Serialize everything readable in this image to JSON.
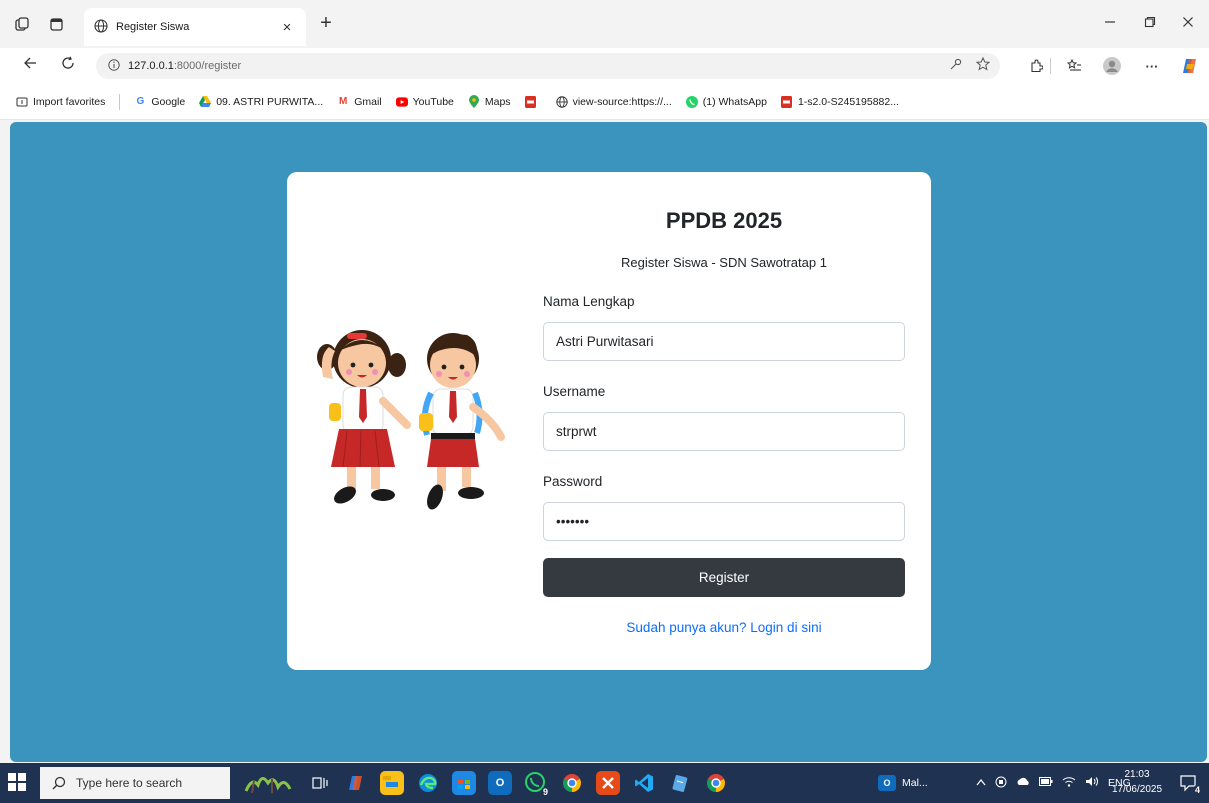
{
  "browser": {
    "tab_title": "Register Siswa",
    "tab_close": "×",
    "new_tab": "+",
    "url_host": "127.0.0.1",
    "url_rest": ":8000/register",
    "more": "···"
  },
  "favorites": [
    {
      "label": "Import favorites",
      "icon": "import-favorites-icon"
    },
    {
      "label": "Google",
      "icon": "google-icon"
    },
    {
      "label": "09. ASTRI PURWITA...",
      "icon": "google-drive-icon"
    },
    {
      "label": "Gmail",
      "icon": "gmail-icon"
    },
    {
      "label": "YouTube",
      "icon": "youtube-icon"
    },
    {
      "label": "Maps",
      "icon": "maps-icon"
    },
    {
      "label": "",
      "icon": "pdf-icon"
    },
    {
      "label": "view-source:https://...",
      "icon": "globe-icon"
    },
    {
      "label": "(1) WhatsApp",
      "icon": "whatsapp-icon"
    },
    {
      "label": "1-s2.0-S245195882...",
      "icon": "pdf-icon"
    }
  ],
  "form": {
    "title": "PPDB 2025",
    "subtitle": "Register Siswa - SDN Sawotratap 1",
    "name_label": "Nama Lengkap",
    "name_value": "Astri Purwitasari",
    "username_label": "Username",
    "username_value": "strprwt",
    "password_label": "Password",
    "password_value": "•••••••",
    "submit_label": "Register",
    "login_link": "Sudah punya akun? Login di sini"
  },
  "taskbar": {
    "search_placeholder": "Type here to search",
    "app_label": "Mal...",
    "whatsapp_badge": "9",
    "language": "ENG",
    "time": "21:03",
    "date": "17/06/2025",
    "notification_count": "4"
  },
  "colors": {
    "page_bg": "#3a94bd",
    "button_bg": "#343a40",
    "link": "#0d6efd"
  }
}
